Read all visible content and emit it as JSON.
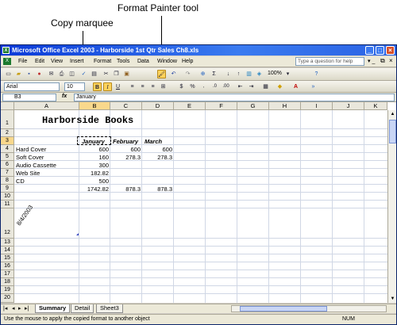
{
  "callouts": {
    "format_painter": "Format Painter tool",
    "copy_marquee": "Copy marquee"
  },
  "window": {
    "title": "Microsoft Office Excel 2003 - Harborside 1st Qtr Sales Ch8.xls"
  },
  "menu": {
    "items": [
      "File",
      "Edit",
      "View",
      "Insert",
      "Format",
      "Tools",
      "Data",
      "Window",
      "Help"
    ],
    "ask_placeholder": "Type a question for help"
  },
  "standard_toolbar": {
    "zoom": "100%"
  },
  "formatting_toolbar": {
    "font": "Arial",
    "size": "10"
  },
  "formula_bar": {
    "name_box": "B3",
    "fx": "fx",
    "value": "January"
  },
  "columns": [
    "A",
    "B",
    "C",
    "D",
    "E",
    "F",
    "G",
    "H",
    "I",
    "J",
    "K"
  ],
  "rows": [
    "1",
    "2",
    "3",
    "4",
    "5",
    "6",
    "7",
    "8",
    "9",
    "10",
    "11",
    "12",
    "13",
    "14",
    "15",
    "16",
    "17",
    "18",
    "19",
    "20"
  ],
  "sheet": {
    "title": "Harborside Books",
    "month_headers": [
      "January",
      "February",
      "March"
    ],
    "data_rows": [
      {
        "label": "Hard Cover",
        "b": "600",
        "c": "600",
        "d": "600"
      },
      {
        "label": "Soft Cover",
        "b": "160",
        "c": "278.3",
        "d": "278.3"
      },
      {
        "label": "Audio Cassette",
        "b": "300",
        "c": "",
        "d": ""
      },
      {
        "label": "Web Site",
        "b": "182.82",
        "c": "",
        "d": ""
      },
      {
        "label": "CD",
        "b": "500",
        "c": "",
        "d": ""
      },
      {
        "label": "",
        "b": "1742.82",
        "c": "878.3",
        "d": "878.3"
      }
    ],
    "date_cell": "8/4/2003"
  },
  "sheet_tabs": [
    "Summary",
    "Detail",
    "Sheet3"
  ],
  "status": {
    "message": "Use the mouse to apply the copied format to another object",
    "num": "NUM"
  }
}
